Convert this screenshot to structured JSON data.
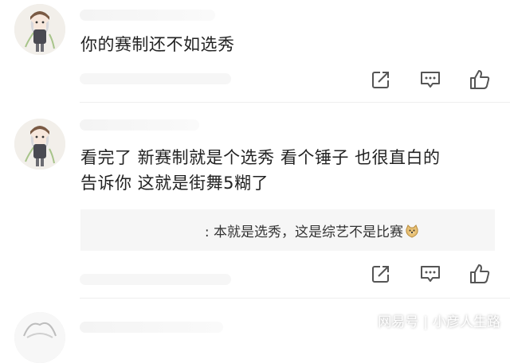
{
  "comments": [
    {
      "content": "你的赛制还不如选秀",
      "actions": [
        "share-icon",
        "comment-icon",
        "like-icon"
      ]
    },
    {
      "content_lines": [
        "看完了 新赛制就是个选秀 看个锤子 也很直白的",
        "告诉你 这就是街舞5糊了"
      ],
      "reply": {
        "text": ": 本就是选秀，这是综艺不是比赛",
        "emoji": "doge-emoji"
      },
      "actions": [
        "share-icon",
        "comment-icon",
        "like-icon"
      ]
    }
  ],
  "watermark": {
    "brand": "网易号",
    "author": "小彦人生路"
  },
  "colors": {
    "text": "#222222",
    "icon": "#555555",
    "reply_bg": "#f6f6f6",
    "divider": "#eeeeee"
  }
}
